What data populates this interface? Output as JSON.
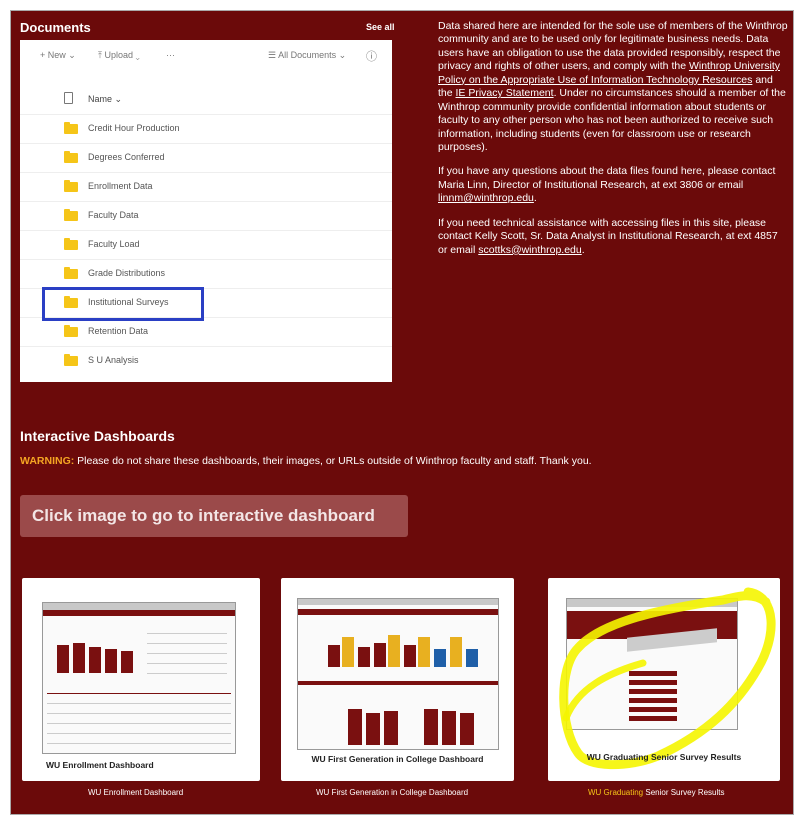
{
  "documents": {
    "title": "Documents",
    "see_all": "See all",
    "toolbar": {
      "new": "+ New ⌄",
      "upload": "⤒ Upload ⌄",
      "more": "···",
      "view": "☰ All Documents ⌄",
      "info": "ⓘ"
    },
    "name_header": "Name ⌄",
    "folders": [
      "Credit Hour Production",
      "Degrees Conferred",
      "Enrollment Data",
      "Faculty Data",
      "Faculty Load",
      "Grade Distributions",
      "Institutional Surveys",
      "Retention Data",
      "S U Analysis"
    ]
  },
  "info": {
    "p1_a": "Data shared here are intended for the sole use of members of the Winthrop community and are to be used only for legitimate business needs. Data users have an obligation to use the data provided responsibly, respect the privacy and rights of other users, and comply with the ",
    "p1_link1": "Winthrop University Policy on the Appropriate Use of Information Technology Resources",
    "p1_b": " and the ",
    "p1_link2": "IE Privacy Statement",
    "p1_c": ". Under no circumstances should a member of the Winthrop community provide confidential information about students or faculty to any other person who has not been authorized to receive such information, including students (even for classroom use or research purposes).",
    "p2_a": "If you have any questions about the data files found here, please contact Maria Linn, Director of Institutional Research, at ext 3806 or email ",
    "p2_link": "linnm@winthrop.edu",
    "p2_b": ".",
    "p3_a": "If you need technical assistance with accessing files in this site, please contact Kelly Scott, Sr. Data Analyst in Institutional Research, at ext 4857 or email ",
    "p3_link": "scottks@winthrop.edu",
    "p3_b": "."
  },
  "dashboards": {
    "title": "Interactive Dashboards",
    "warning_label": "WARNING:",
    "warning_text": " Please do not share these dashboards, their images, or URLs outside of Winthrop faculty and staff. Thank you.",
    "click_button": "Click image to go to interactive dashboard",
    "cards": [
      {
        "caption": "WU Enrollment Dashboard",
        "link": "WU Enrollment Dashboard"
      },
      {
        "caption": "WU First Generation in College Dashboard",
        "link": "WU First Generation in College Dashboard"
      },
      {
        "caption": "WU Graduating Senior Survey Results",
        "link_a": "WU Graduating",
        "link_b": " Senior Survey Results"
      }
    ]
  },
  "colors": {
    "background": "#6b0a0a",
    "highlight_box": "#2a3fc4",
    "warning": "#f5a623",
    "folder": "#f5c518",
    "scribble": "#f5f500"
  }
}
